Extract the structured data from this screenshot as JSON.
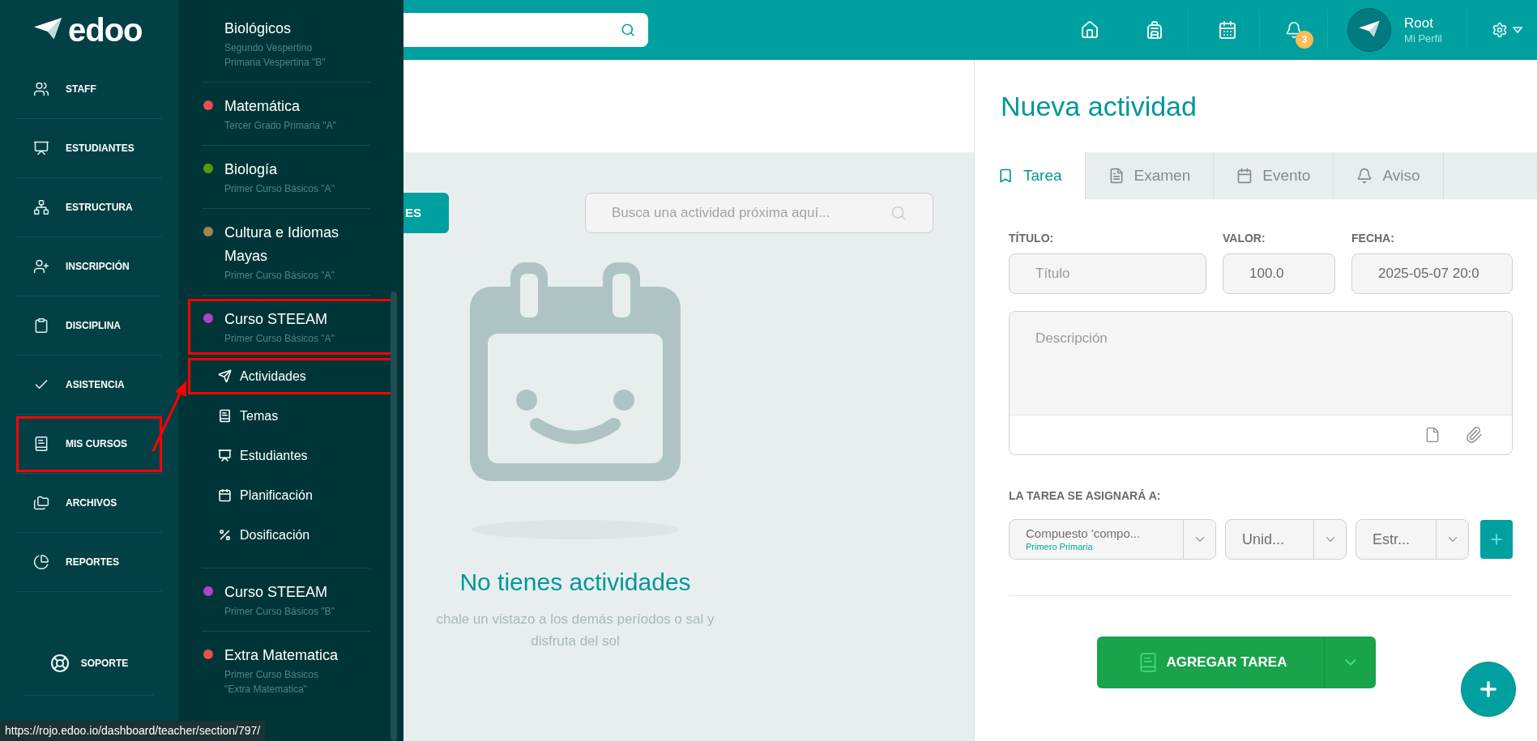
{
  "sidebar": {
    "logo": "edoo",
    "items": [
      {
        "label": "STAFF",
        "highlighted": false
      },
      {
        "label": "ESTUDIANTES",
        "highlighted": false
      },
      {
        "label": "ESTRUCTURA",
        "highlighted": false
      },
      {
        "label": "INSCRIPCIÓN",
        "highlighted": false
      },
      {
        "label": "DISCIPLINA",
        "highlighted": false
      },
      {
        "label": "ASISTENCIA",
        "highlighted": false
      },
      {
        "label": "MIS CURSOS",
        "highlighted": true
      },
      {
        "label": "ARCHIVOS",
        "highlighted": false
      },
      {
        "label": "REPORTES",
        "highlighted": false
      }
    ],
    "support": "SOPORTE"
  },
  "courses": [
    {
      "title": "Biológicos",
      "subtitle_lines": [
        "Segundo Vespertino",
        "Primaria Vespertina \"B\""
      ],
      "highlighted": false
    },
    {
      "title": "Matemática",
      "subtitle_lines": [
        "Tercer Grado Primaria \"A\""
      ],
      "color": "#e84f4f",
      "highlighted": false
    },
    {
      "title": "Biología",
      "subtitle_lines": [
        "Primer Curso Básicos \"A\""
      ],
      "color": "#5a9a06",
      "highlighted": false
    },
    {
      "title": "Cultura e Idiomas Mayas",
      "subtitle_lines": [
        "Primer Curso Básicos \"A\""
      ],
      "color": "#a08850",
      "highlighted": false
    },
    {
      "title": "Curso STEEAM",
      "subtitle_lines": [
        "Primer Curso Básicos \"A\""
      ],
      "color": "#b042c8",
      "highlighted": true,
      "children": [
        {
          "label": "Actividades",
          "highlighted": true
        },
        {
          "label": "Temas",
          "highlighted": false
        },
        {
          "label": "Estudiantes",
          "highlighted": false
        },
        {
          "label": "Planificación",
          "highlighted": false
        },
        {
          "label": "Dosificación",
          "highlighted": false
        }
      ]
    },
    {
      "title": "Curso STEEAM",
      "subtitle_lines": [
        "Primer Curso Básicos \"B\""
      ],
      "color": "#b042c8",
      "highlighted": false
    },
    {
      "title": "Extra Matematica",
      "subtitle_lines": [
        "Primer Curso Básicos",
        "\"Extra Matematica\""
      ],
      "color": "#e84f4f",
      "highlighted": false
    }
  ],
  "topbar": {
    "notifications_badge": "3",
    "user": {
      "name": "Root",
      "link": "Mi Perfil"
    }
  },
  "middle": {
    "filter_button": "ES",
    "search": {
      "placeholder": "Busca una actividad próxima aquí..."
    },
    "empty_state": {
      "title": "No tienes actividades",
      "message_lines": [
        "chale un vistazo a los demás períodos o sal y",
        "disfruta del sol"
      ]
    }
  },
  "new_activity": {
    "title": "Nueva actividad",
    "tabs": [
      {
        "label": "Tarea",
        "selected": true
      },
      {
        "label": "Examen",
        "selected": false
      },
      {
        "label": "Evento",
        "selected": false
      },
      {
        "label": "Aviso",
        "selected": false
      }
    ],
    "title_label": "TÍTULO:",
    "title_placeholder": "Título",
    "value_label": "VALOR:",
    "value": "100.0",
    "date_label": "FECHA:",
    "date": "2025-05-07 20:0",
    "description_placeholder": "Descripción",
    "assign_label": "LA TAREA SE ASIGNARÁ A:",
    "selects": [
      {
        "value": "Compuesto 'compo...",
        "sub": "Primero Primaria"
      },
      {
        "value": "Unid..."
      },
      {
        "value": "Estr..."
      }
    ],
    "submit": "AGREGAR TAREA"
  },
  "status_url": "https://rojo.edoo.io/dashboard/teacher/section/797/"
}
